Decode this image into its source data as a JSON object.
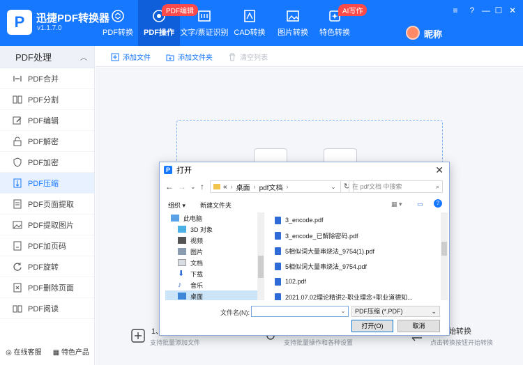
{
  "app": {
    "name": "迅捷PDF转换器",
    "version": "v1.1.7.0",
    "logo_letter": "P"
  },
  "nav": [
    {
      "label": "PDF转换",
      "icon": "pdf-convert-icon"
    },
    {
      "label": "PDF操作",
      "icon": "pdf-operate-icon",
      "badge": "PDF编辑",
      "active": true
    },
    {
      "label": "文字/票证识别",
      "icon": "ocr-icon"
    },
    {
      "label": "CAD转换",
      "icon": "cad-icon"
    },
    {
      "label": "图片转换",
      "icon": "image-icon"
    },
    {
      "label": "特色转换",
      "icon": "special-icon",
      "badge": "AI写作"
    }
  ],
  "user": {
    "nickname": "昵称"
  },
  "sidebar": {
    "header": "PDF处理",
    "items": [
      {
        "label": "PDF合并"
      },
      {
        "label": "PDF分割"
      },
      {
        "label": "PDF编辑"
      },
      {
        "label": "PDF解密"
      },
      {
        "label": "PDF加密"
      },
      {
        "label": "PDF压缩",
        "active": true
      },
      {
        "label": "PDF页面提取"
      },
      {
        "label": "PDF提取图片"
      },
      {
        "label": "PDF加页码"
      },
      {
        "label": "PDF旋转"
      },
      {
        "label": "PDF删除页面"
      },
      {
        "label": "PDF阅读"
      }
    ],
    "footer": {
      "service": "在线客服",
      "products": "特色产品"
    }
  },
  "toolbar": {
    "add_file": "添加文件",
    "add_folder": "添加文件夹",
    "clear_list": "清空列表"
  },
  "steps": [
    {
      "title": "1、",
      "sub": "支持批量添加文件"
    },
    {
      "title": "",
      "sub": "支持批量操作和各种设置"
    },
    {
      "title": "始转换",
      "sub": "点击转换按钮开始转换"
    }
  ],
  "dialog": {
    "title": "打开",
    "path": [
      "«",
      "桌面",
      "pdf文档"
    ],
    "search_placeholder": "在 pdf文档 中搜索",
    "organize": "组织",
    "new_folder": "新建文件夹",
    "tree": [
      "此电脑",
      "3D 对象",
      "视频",
      "图片",
      "文档",
      "下载",
      "音乐",
      "桌面"
    ],
    "files": [
      "3_encode.pdf",
      "3_encode_已解除密码.pdf",
      "5相似词大量串烧法_9754(1).pdf",
      "5相似词大量串烧法_9754.pdf",
      "102.pdf",
      "2021.07.02理论精讲2-职业理念+职业道德知..."
    ],
    "filename_label": "文件名(N):",
    "filename_value": "",
    "filetype": "PDF压缩 (*.PDF)",
    "open_button": "打开(O)",
    "cancel_button": "取消"
  },
  "colors": {
    "brand": "#1677ff",
    "badge": "#ff4a4a"
  }
}
